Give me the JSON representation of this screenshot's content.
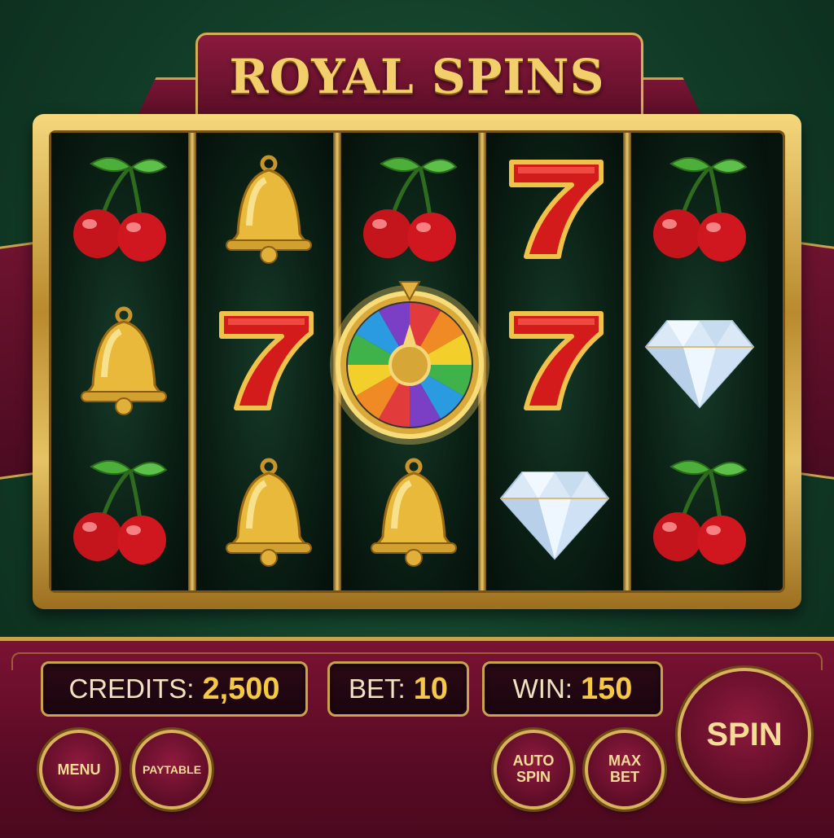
{
  "game": {
    "title": "ROYAL SPINS"
  },
  "reels": [
    {
      "symbols": [
        "cherry",
        "bell",
        "cherry"
      ]
    },
    {
      "symbols": [
        "bell",
        "seven",
        "bell"
      ]
    },
    {
      "symbols": [
        "cherry",
        "wheel",
        "bell"
      ]
    },
    {
      "symbols": [
        "seven",
        "seven",
        "diamond"
      ]
    },
    {
      "symbols": [
        "cherry",
        "diamond",
        "cherry"
      ]
    }
  ],
  "status": {
    "credits_label": "CREDITS:",
    "credits_value": "2,500",
    "bet_label": "BET:",
    "bet_value": "10",
    "win_label": "WIN:",
    "win_value": "150"
  },
  "buttons": {
    "menu": "MENU",
    "paytable": "PAYTABLE",
    "auto_spin_line1": "AUTO",
    "auto_spin_line2": "SPIN",
    "max_bet_line1": "MAX",
    "max_bet_line2": "BET",
    "spin": "SPIN"
  },
  "colors": {
    "felt_green": "#123d28",
    "burgundy": "#6e1330",
    "gold": "#c9a24a",
    "value_gold": "#f5c846"
  }
}
